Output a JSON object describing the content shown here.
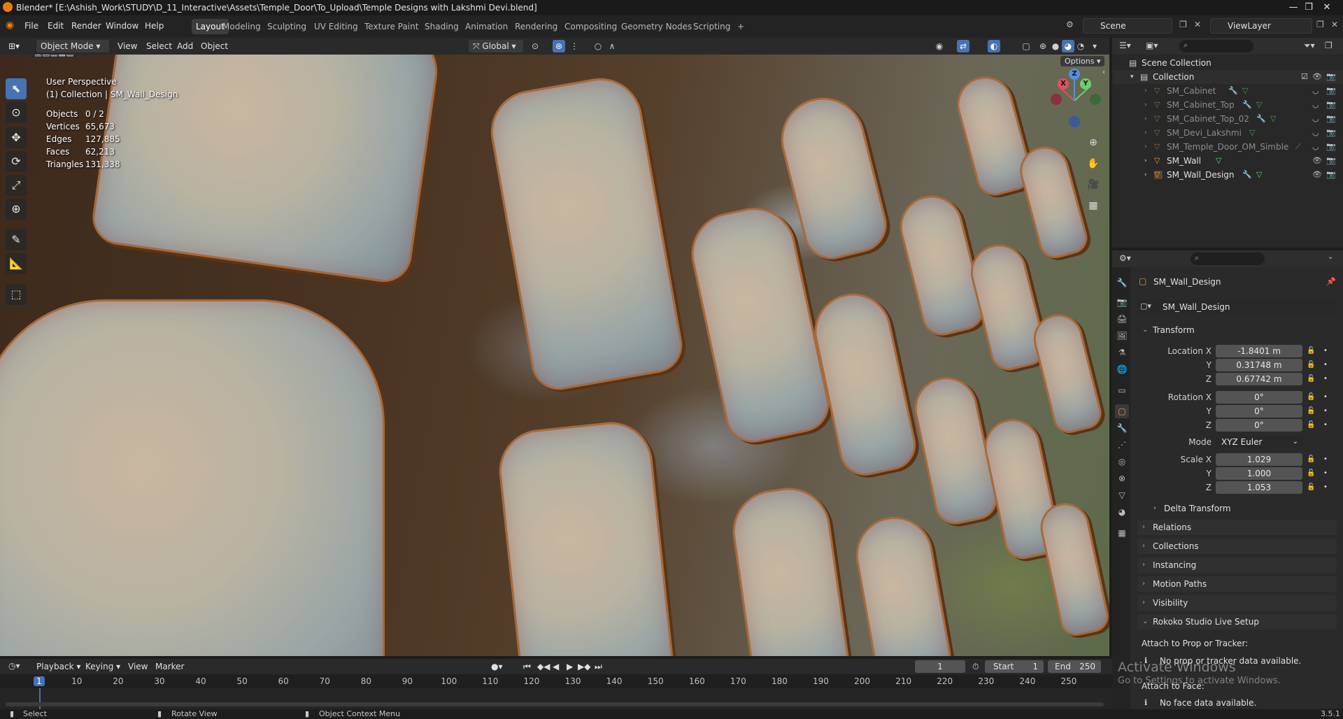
{
  "window": {
    "title": "Blender* [E:\\Ashish_Work\\STUDY\\D_11_Interactive\\Assets\\Temple_Door\\To_Upload\\Temple Designs with Lakshmi Devi.blend]",
    "controls": [
      "—",
      "❐",
      "✕"
    ]
  },
  "menus": [
    "File",
    "Edit",
    "Render",
    "Window",
    "Help"
  ],
  "workspaces": [
    "Layout",
    "Modeling",
    "Sculpting",
    "UV Editing",
    "Texture Paint",
    "Shading",
    "Animation",
    "Rendering",
    "Compositing",
    "Geometry Nodes",
    "Scripting",
    "+"
  ],
  "active_workspace": "Layout",
  "scene": "Scene",
  "view_layer": "ViewLayer",
  "viewport_header": {
    "mode": "Object Mode",
    "menus": [
      "View",
      "Select",
      "Add",
      "Object"
    ],
    "orientation": "Global",
    "options": "Options"
  },
  "viewport": {
    "perspective": "User Perspective",
    "collection": "(1) Collection | SM_Wall_Design",
    "stats": [
      {
        "label": "Objects",
        "value": "0 / 2"
      },
      {
        "label": "Vertices",
        "value": "65,673"
      },
      {
        "label": "Edges",
        "value": "127,885"
      },
      {
        "label": "Faces",
        "value": "62,213"
      },
      {
        "label": "Triangles",
        "value": "131,338"
      }
    ],
    "gizmo": {
      "x": "X",
      "y": "Y",
      "z": "Z"
    }
  },
  "outliner": {
    "root": "Scene Collection",
    "collection": "Collection",
    "items": [
      {
        "name": "SM_Cabinet",
        "dim": true
      },
      {
        "name": "SM_Cabinet_Top",
        "dim": true
      },
      {
        "name": "SM_Cabinet_Top_02",
        "dim": true
      },
      {
        "name": "SM_Devi_Lakshmi",
        "dim": true
      },
      {
        "name": "SM_Temple_Door_OM_Simble",
        "dim": true
      },
      {
        "name": "SM_Wall",
        "dim": false
      },
      {
        "name": "SM_Wall_Design",
        "dim": false
      }
    ]
  },
  "properties": {
    "object_name": "SM_Wall_Design",
    "data_name": "SM_Wall_Design",
    "transform_label": "Transform",
    "location": {
      "label": "Location X",
      "x": "-1.8401 m",
      "y": "0.31748 m",
      "z": "0.67742 m"
    },
    "rotation": {
      "label": "Rotation X",
      "x": "0°",
      "y": "0°",
      "z": "0°"
    },
    "mode_label": "Mode",
    "mode": "XYZ Euler",
    "scale": {
      "label": "Scale X",
      "x": "1.029",
      "y": "1.000",
      "z": "1.053"
    },
    "axis_y": "Y",
    "axis_z": "Z",
    "panels": [
      "Delta Transform",
      "Relations",
      "Collections",
      "Instancing",
      "Motion Paths",
      "Visibility",
      "Rokoko Studio Live Setup"
    ],
    "rokoko": {
      "prop_label": "Attach to Prop or Tracker:",
      "prop_msg": "No prop or tracker data available.",
      "face_label": "Attach to Face:",
      "face_msg": "No face data available."
    }
  },
  "timeline": {
    "menus": [
      "Playback",
      "Keying",
      "View",
      "Marker"
    ],
    "current_frame": "1",
    "start_label": "Start",
    "start": "1",
    "end_label": "End",
    "end": "250",
    "ruler": [
      "1",
      "10",
      "20",
      "30",
      "40",
      "50",
      "60",
      "70",
      "80",
      "90",
      "100",
      "110",
      "120",
      "130",
      "140",
      "150",
      "160",
      "170",
      "180",
      "190",
      "200",
      "210",
      "220",
      "230",
      "240",
      "250"
    ]
  },
  "status": {
    "select": "Select",
    "rotate": "Rotate View",
    "context": "Object Context Menu",
    "version": "3.5.1"
  },
  "watermark": {
    "line1": "Activate Windows",
    "line2": "Go to Settings to activate Windows."
  }
}
